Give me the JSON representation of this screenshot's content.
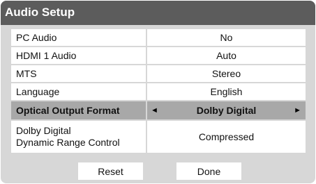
{
  "title": "Audio Setup",
  "rows": [
    {
      "label": "PC Audio",
      "value": "No"
    },
    {
      "label": "HDMI 1 Audio",
      "value": "Auto"
    },
    {
      "label": "MTS",
      "value": "Stereo"
    },
    {
      "label": "Language",
      "value": "English"
    },
    {
      "label": "Optical Output Format",
      "value": "Dolby Digital"
    },
    {
      "label_line1": "Dolby Digital",
      "label_line2": "Dynamic Range Control",
      "value": "Compressed"
    }
  ],
  "selected_row": 4,
  "arrows": {
    "left": "◄",
    "right": "►"
  },
  "buttons": {
    "reset": "Reset",
    "done": "Done"
  },
  "colors": {
    "title_bar": "#5c5c5c",
    "panel_background": "#d7d7d7",
    "selected_row": "#a8a8a8",
    "cell_background": "#ffffff"
  }
}
